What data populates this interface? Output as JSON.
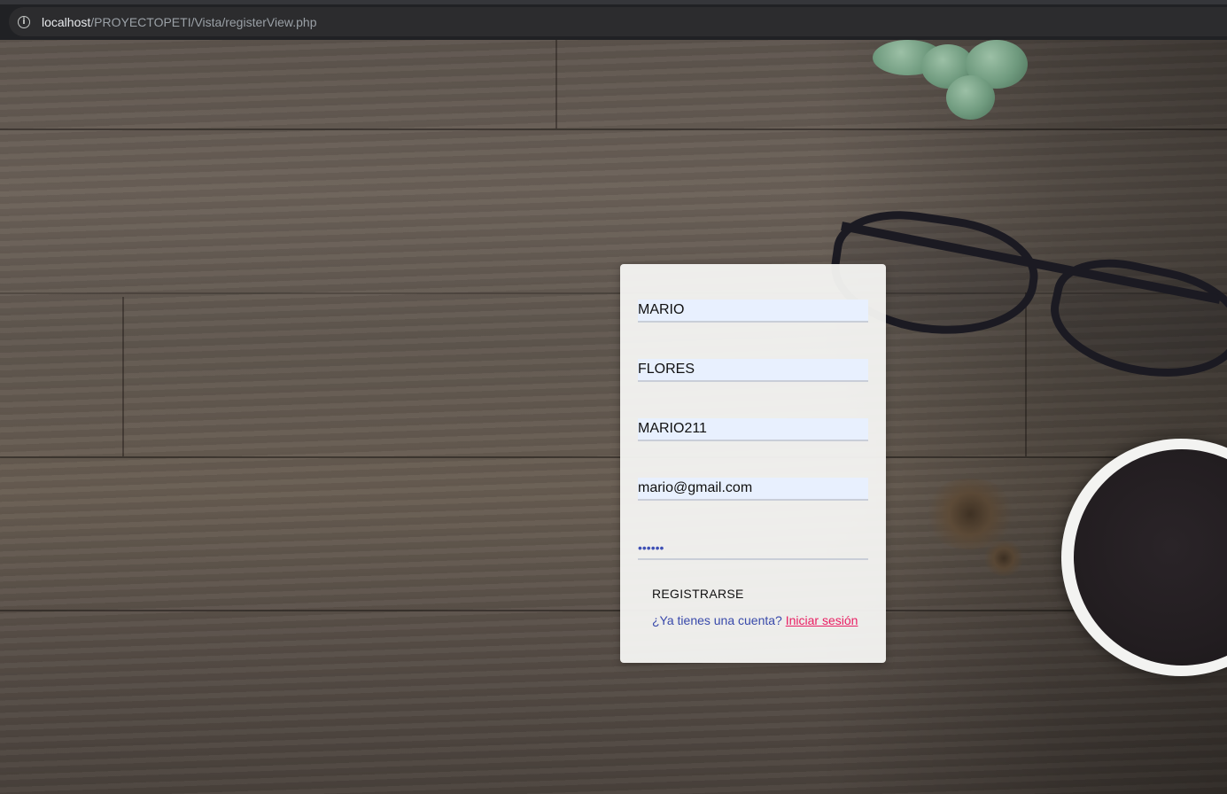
{
  "browser": {
    "url_host": "localhost",
    "url_path": "/PROYECTOPETI/Vista/registerView.php"
  },
  "form": {
    "first_name": "MARIO",
    "last_name": "FLORES",
    "username": "MARIO211",
    "email": "mario@gmail.com",
    "password_mask": "••••••",
    "register_label": "REGISTRARSE",
    "login_prompt": "¿Ya tienes una cuenta?",
    "login_link": "Iniciar sesión"
  },
  "colors": {
    "card_bg": "#f6f5f3",
    "autofill_bg": "#e8f0fe",
    "prompt_text": "#3949ab",
    "link": "#e91e63"
  }
}
